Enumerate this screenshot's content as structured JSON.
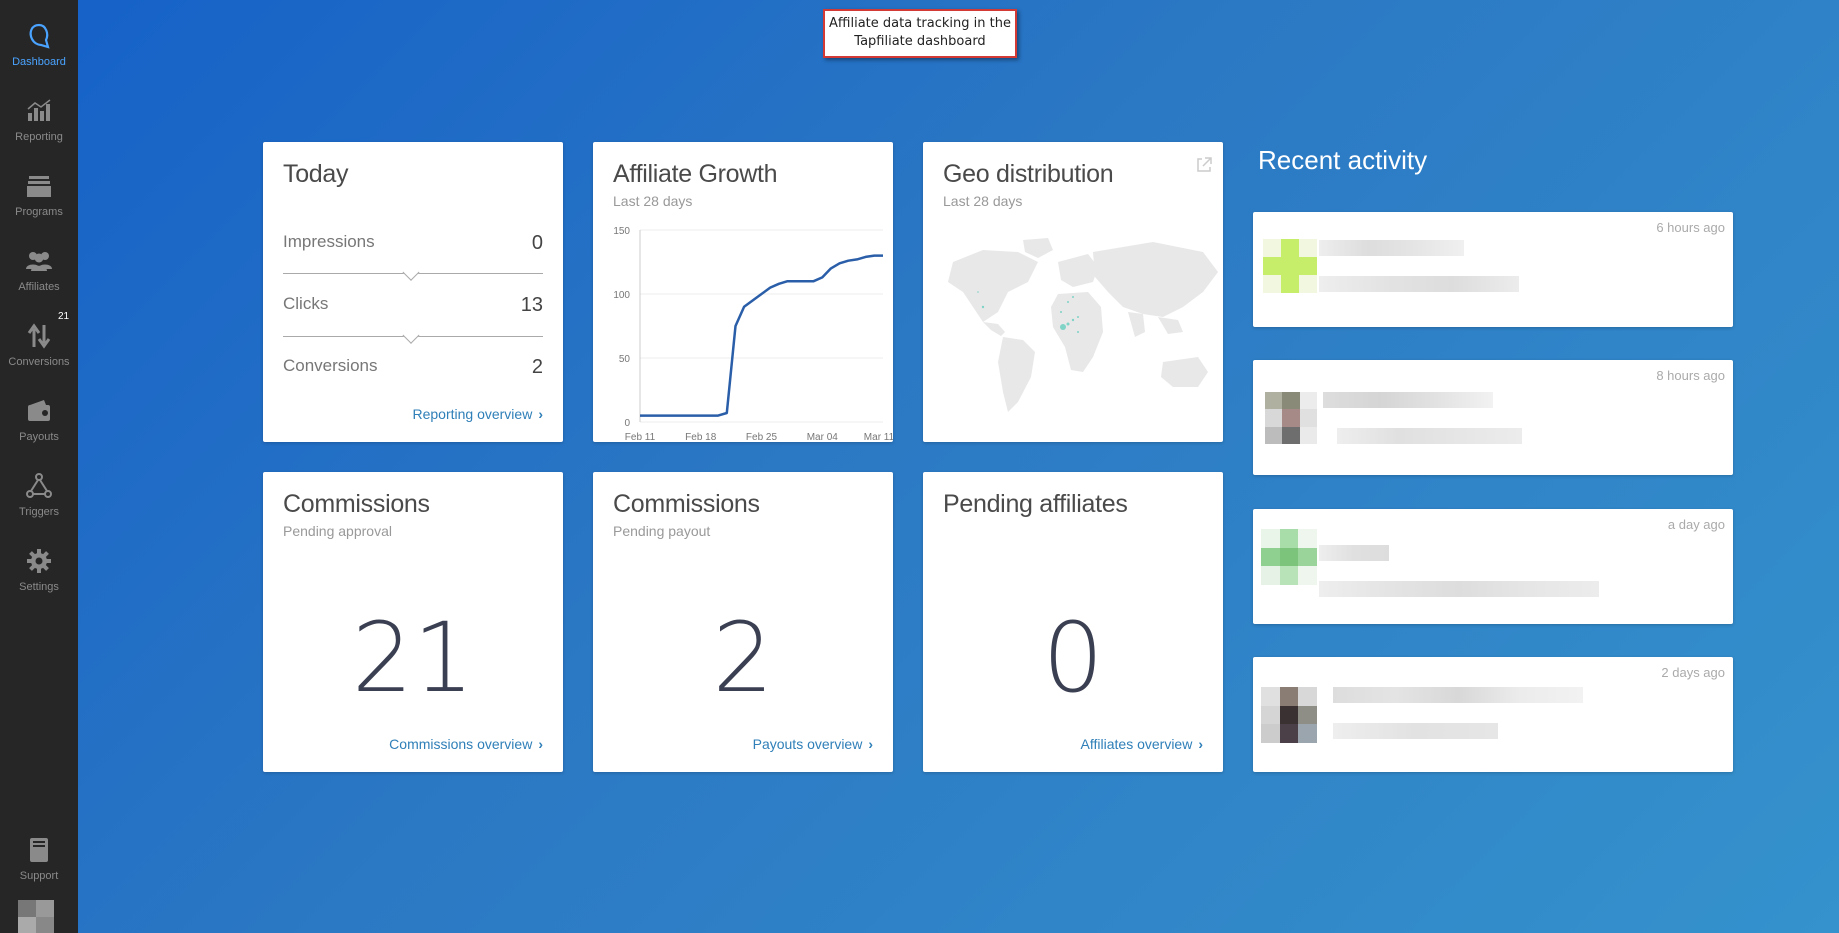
{
  "callout": {
    "line1": "Affiliate data tracking in the",
    "line2": "Tapfiliate dashboard"
  },
  "sidebar": {
    "items": [
      {
        "label": "Dashboard",
        "icon": "logo-icon",
        "active": true
      },
      {
        "label": "Reporting",
        "icon": "bar-chart-icon"
      },
      {
        "label": "Programs",
        "icon": "programs-icon"
      },
      {
        "label": "Affiliates",
        "icon": "users-icon"
      },
      {
        "label": "Conversions",
        "icon": "arrows-icon",
        "badge": "21"
      },
      {
        "label": "Payouts",
        "icon": "wallet-icon"
      },
      {
        "label": "Triggers",
        "icon": "triggers-icon"
      },
      {
        "label": "Settings",
        "icon": "gear-icon"
      }
    ],
    "support": {
      "label": "Support",
      "icon": "book-icon"
    }
  },
  "today": {
    "title": "Today",
    "rows": [
      {
        "label": "Impressions",
        "value": "0"
      },
      {
        "label": "Clicks",
        "value": "13"
      },
      {
        "label": "Conversions",
        "value": "2"
      }
    ],
    "link": "Reporting overview"
  },
  "growth": {
    "title": "Affiliate Growth",
    "subtitle": "Last 28 days"
  },
  "geo": {
    "title": "Geo distribution",
    "subtitle": "Last 28 days"
  },
  "commissions_approval": {
    "title": "Commissions",
    "subtitle": "Pending approval",
    "value": "21",
    "link": "Commissions overview"
  },
  "commissions_payout": {
    "title": "Commissions",
    "subtitle": "Pending payout",
    "value": "2",
    "link": "Payouts overview"
  },
  "pending_affiliates": {
    "title": "Pending affiliates",
    "value": "0",
    "link": "Affiliates overview"
  },
  "recent_activity": {
    "title": "Recent activity",
    "items": [
      {
        "time": "6 hours ago"
      },
      {
        "time": "8 hours ago"
      },
      {
        "time": "a day ago"
      },
      {
        "time": "2 days ago"
      }
    ]
  },
  "chart_data": {
    "type": "line",
    "x_tick_labels": [
      "Feb 11",
      "Feb 18",
      "Feb 25",
      "Mar 04",
      "Mar 11"
    ],
    "y_ticks": [
      0,
      50,
      100,
      150
    ],
    "ylim": [
      0,
      150
    ],
    "series": [
      {
        "values": [
          5,
          5,
          5,
          5,
          5,
          5,
          5,
          5,
          5,
          5,
          7,
          75,
          90,
          95,
          100,
          105,
          108,
          110,
          110,
          110,
          110,
          113,
          120,
          124,
          126,
          127,
          129,
          130,
          130
        ]
      }
    ],
    "color": "#2a5ea8",
    "grid": true
  }
}
